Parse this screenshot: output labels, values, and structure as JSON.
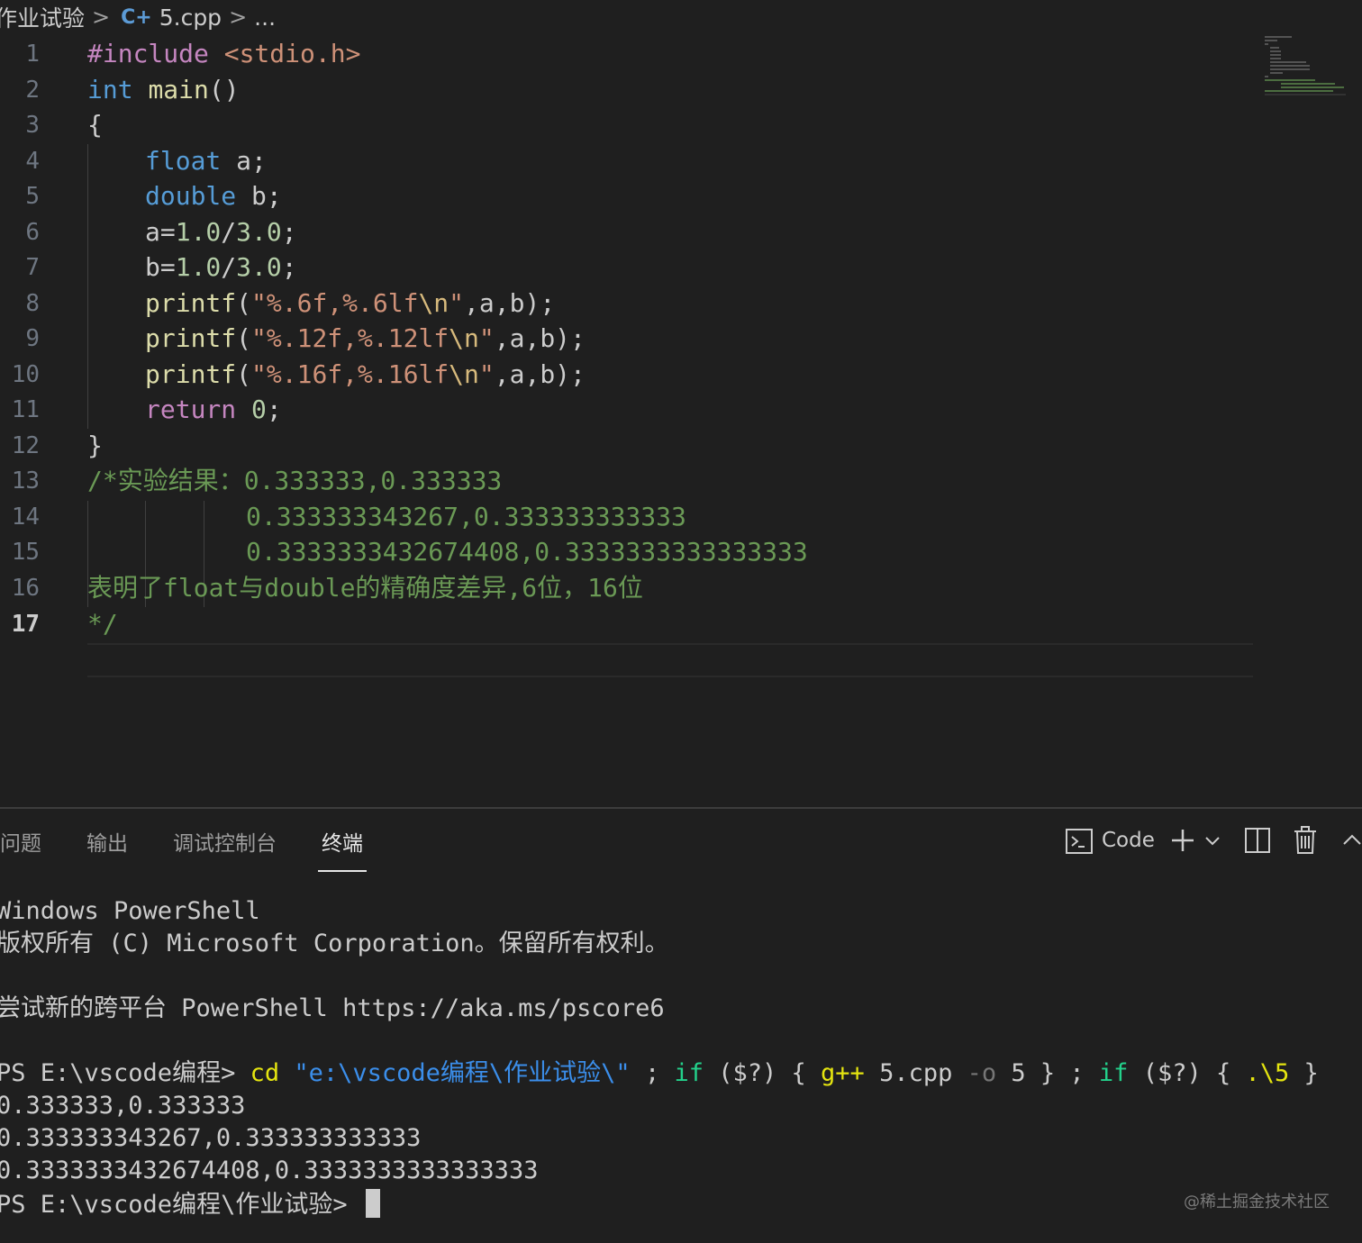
{
  "breadcrumb": {
    "folder": "作业试验",
    "separator": ">",
    "file_icon": "C+",
    "file": "5.cpp",
    "more": "..."
  },
  "editor": {
    "line_numbers": [
      "1",
      "2",
      "3",
      "4",
      "5",
      "6",
      "7",
      "8",
      "9",
      "10",
      "11",
      "12",
      "13",
      "14",
      "15",
      "16",
      "17"
    ],
    "active_line": 17,
    "lines": {
      "l1": {
        "p1": "#include ",
        "p2": "<stdio.h>"
      },
      "l2": {
        "p1": "int",
        "p2": " ",
        "p3": "main",
        "p4": "()"
      },
      "l3": "{",
      "l4": {
        "p1": "float",
        "p2": " a;"
      },
      "l5": {
        "p1": "double",
        "p2": " b;"
      },
      "l6": {
        "p1": "a=",
        "p2": "1.0",
        "p3": "/",
        "p4": "3.0",
        "p5": ";"
      },
      "l7": {
        "p1": "b=",
        "p2": "1.0",
        "p3": "/",
        "p4": "3.0",
        "p5": ";"
      },
      "l8": {
        "p1": "printf",
        "p2": "(",
        "p3": "\"%.6f,%.6lf",
        "p4": "\\n",
        "p5": "\"",
        "p6": ",a,b);"
      },
      "l9": {
        "p1": "printf",
        "p2": "(",
        "p3": "\"%.12f,%.12lf",
        "p4": "\\n",
        "p5": "\"",
        "p6": ",a,b);"
      },
      "l10": {
        "p1": "printf",
        "p2": "(",
        "p3": "\"%.16f,%.16lf",
        "p4": "\\n",
        "p5": "\"",
        "p6": ",a,b);"
      },
      "l11": {
        "p1": "return",
        "p2": " ",
        "p3": "0",
        "p4": ";"
      },
      "l12": "}",
      "l13": "/*实验结果：0.333333,0.333333",
      "l14": "0.333333343267,0.333333333333",
      "l15": "0.3333333432674408,0.3333333333333333",
      "l16": "表明了float与double的精确度差异,6位，16位",
      "l17": "*/"
    }
  },
  "panel": {
    "tabs": [
      "问题",
      "输出",
      "调试控制台",
      "终端"
    ],
    "active_tab": "终端",
    "terminal_label": "Code",
    "icons": [
      "terminal-icon",
      "plus-icon",
      "chevron-down-icon",
      "split-icon",
      "trash-icon",
      "chevron-up-icon"
    ]
  },
  "terminal": {
    "line1": "Windows PowerShell",
    "line2": "版权所有 (C) Microsoft Corporation。保留所有权利。",
    "line3": "尝试新的跨平台 PowerShell https://aka.ms/pscore6",
    "cmd": {
      "prompt": "PS E:\\vscode编程> ",
      "cd": "cd",
      "path": "\"e:\\vscode编程\\作业试验\\\"",
      "semi1": " ; ",
      "if1": "if",
      "cond1": " ($?) { ",
      "gpp": "g++",
      "args1": " 5.cpp ",
      "flag": "-o",
      "args2": " 5 } ; ",
      "if2": "if",
      "cond2": " ($?) { ",
      "exe": ".\\5",
      "end": " }"
    },
    "out1": "0.333333,0.333333",
    "out2": "0.333333343267,0.333333333333",
    "out3": "0.3333333432674408,0.3333333333333333",
    "prompt2": "PS E:\\vscode编程\\作业试验> "
  },
  "watermark": "@稀土掘金技术社区"
}
